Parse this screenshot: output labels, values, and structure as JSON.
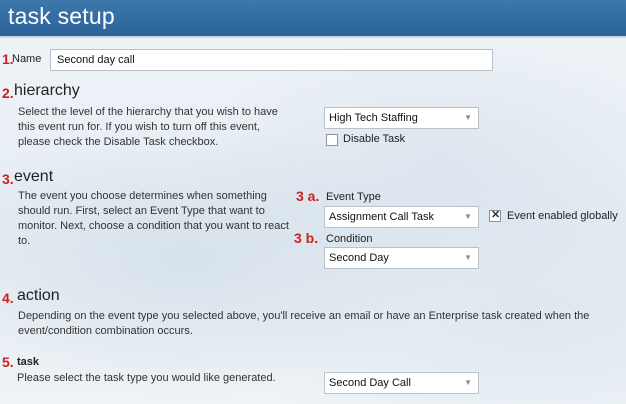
{
  "header": {
    "title": "task setup"
  },
  "name_field": {
    "number": "1.",
    "label": "Name",
    "value": "Second day call"
  },
  "hierarchy": {
    "number": "2.",
    "title": "hierarchy",
    "description_1": "Select the level of the hierarchy that you wish to have",
    "description_2": "this event run for. If you wish to turn off this event,",
    "description_3": "please check the Disable Task checkbox.",
    "select_value": "High Tech Staffing",
    "disable_label": "Disable Task"
  },
  "event": {
    "number": "3.",
    "title": "event",
    "description_1": "The event you choose determines when something",
    "description_2": "should run. First, select an Event Type that want to",
    "description_3": "monitor. Next, choose a condition that you want to react",
    "description_4": "to.",
    "type_number": "3 a.",
    "type_label": "Event Type",
    "type_value": "Assignment Call Task",
    "global_label": "Event enabled globally",
    "condition_number": "3 b.",
    "condition_label": "Condition",
    "condition_value": "Second Day"
  },
  "action": {
    "number": "4.",
    "title": "action",
    "description_1": "Depending on the event type you selected above, you'll receive an email or have an Enterprise task created when the",
    "description_2": "event/condition combination occurs."
  },
  "task": {
    "number": "5.",
    "title": "task",
    "description": "Please select the task type you would like generated.",
    "select_value": "Second Day Call"
  },
  "icons": {
    "dropdown": "chevron-down-icon",
    "checkbox_checked": "x-mark-icon"
  },
  "colors": {
    "header": "#2f6a9f",
    "step_numbers": "#d21d1d"
  }
}
